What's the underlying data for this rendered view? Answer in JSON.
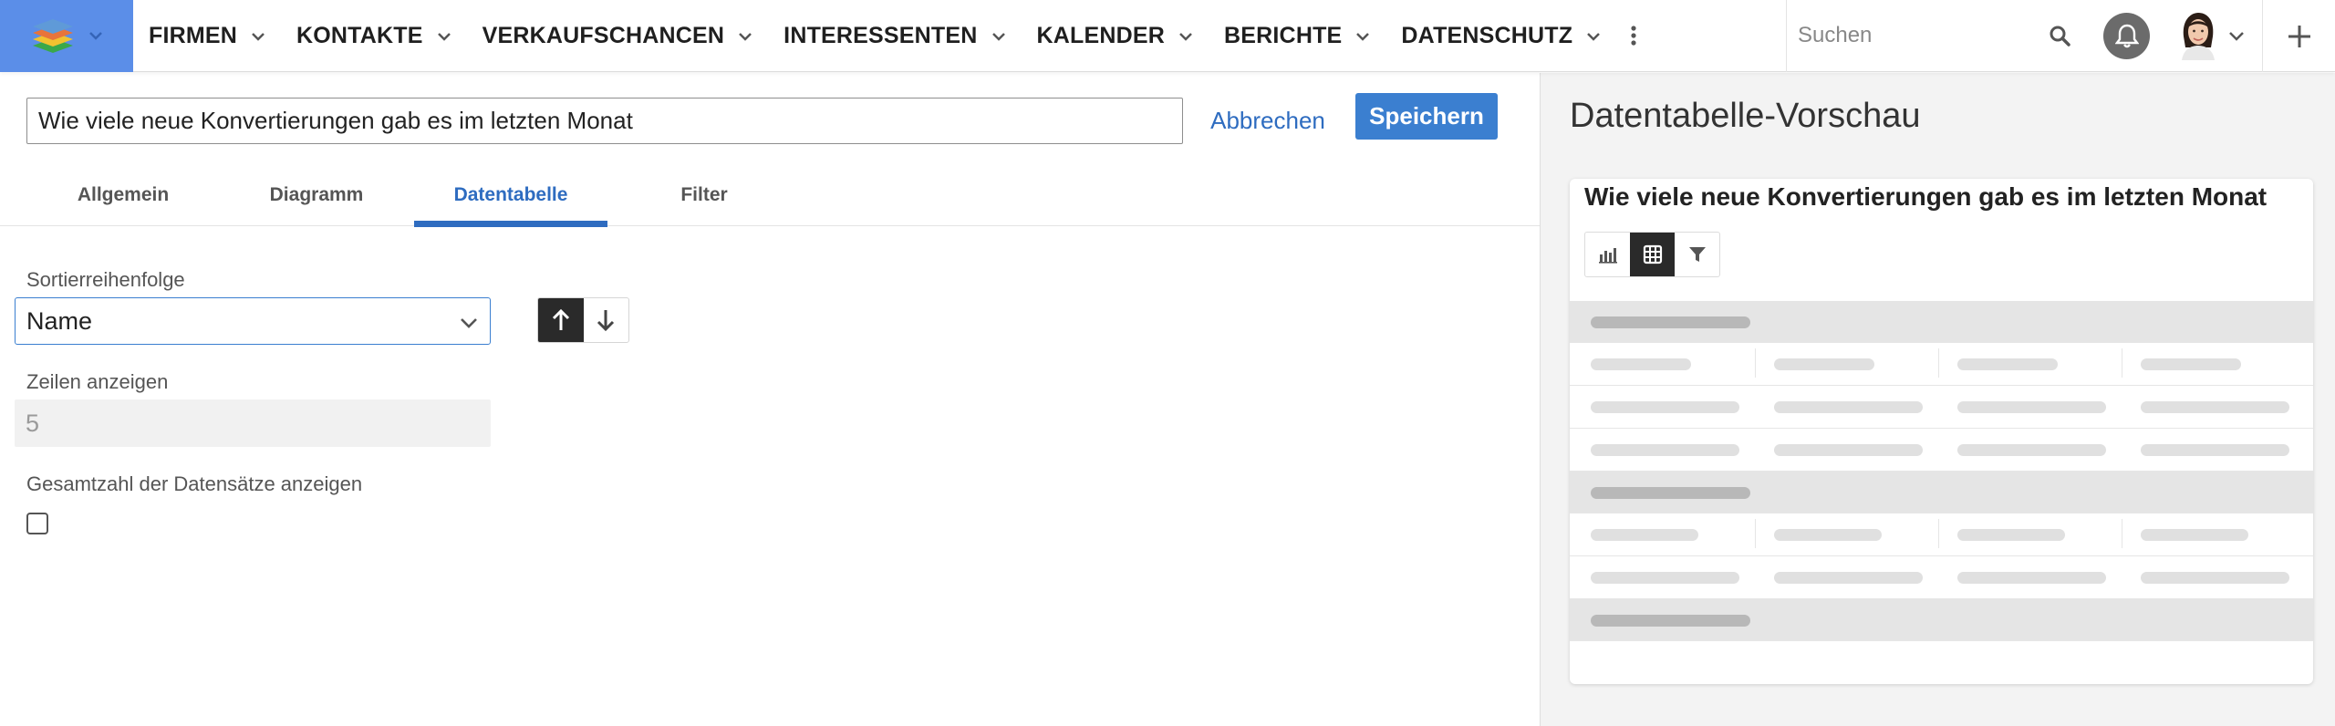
{
  "nav": {
    "menu": [
      {
        "label": "FIRMEN"
      },
      {
        "label": "KONTAKTE"
      },
      {
        "label": "VERKAUFSCHANCEN"
      },
      {
        "label": "INTERESSENTEN"
      },
      {
        "label": "KALENDER"
      },
      {
        "label": "BERICHTE"
      },
      {
        "label": "DATENSCHUTZ"
      }
    ],
    "search_placeholder": "Suchen"
  },
  "editor": {
    "title_value": "Wie viele neue Konvertierungen gab es im letzten Monat",
    "cancel_label": "Abbrechen",
    "save_label": "Speichern",
    "tabs": [
      {
        "label": "Allgemein"
      },
      {
        "label": "Diagramm"
      },
      {
        "label": "Datentabelle",
        "active": true
      },
      {
        "label": "Filter"
      }
    ],
    "sort_order_label": "Sortierreihenfolge",
    "sort_order_value": "Name",
    "sort_direction": "ascending",
    "rows_label": "Zeilen anzeigen",
    "rows_value": "5",
    "total_label": "Gesamtzahl der Datensätze anzeigen",
    "total_checked": false
  },
  "preview": {
    "heading": "Datentabelle-Vorschau",
    "card_title": "Wie viele neue Konvertierungen gab es im letzten Monat",
    "active_view": "table",
    "views": [
      "chart-icon",
      "table-icon",
      "filter-icon"
    ]
  },
  "colors": {
    "accent": "#2e6cc0",
    "save_button": "#3b7fd0",
    "logo_bg": "#5b8ee8",
    "preview_bg": "#f3f3f3"
  }
}
